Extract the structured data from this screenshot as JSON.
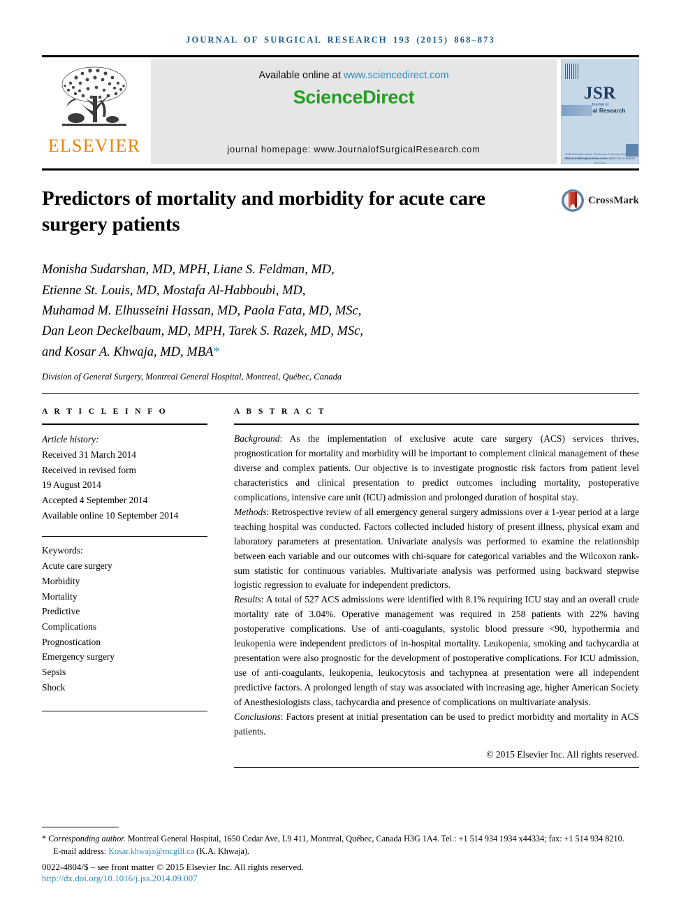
{
  "running_head": "JOURNAL OF SURGICAL RESEARCH 193 (2015) 868–873",
  "masthead": {
    "publisher_name": "ELSEVIER",
    "available_prefix": "Available online at ",
    "available_url": "www.sciencedirect.com",
    "sciencedirect_logo": "ScienceDirect",
    "journal_homepage": "journal homepage: www.JournalofSurgicalResearch.com",
    "cover": {
      "abbr": "JSR",
      "sub_small": "Journal of",
      "sub_main": "Surgical Research",
      "tagline": "Official Publication of the Association for Academic Surgery",
      "bottom_note": "ISSN 0022-4804 Volume 193 Number 2 February 2015\nwww.JournalofSurgicalResearch.com"
    }
  },
  "article": {
    "title": "Predictors of mortality and morbidity for acute care surgery patients",
    "crossmark_label": "CrossMark",
    "authors": [
      "Monisha Sudarshan, MD, MPH, Liane S. Feldman, MD,",
      "Etienne St. Louis, MD, Mostafa Al-Habboubi, MD,",
      "Muhamad M. Elhusseini Hassan, MD, Paola Fata, MD, MSc,",
      "Dan Leon Deckelbaum, MD, MPH, Tarek S. Razek, MD, MSc,",
      "and Kosar A. Khwaja, MD, MBA"
    ],
    "author_marker": "*",
    "affiliation": "Division of General Surgery, Montreal General Hospital, Montreal, Québec, Canada"
  },
  "article_info": {
    "heading": "A R T I C L E   I N F O",
    "history_label": "Article history:",
    "history": [
      "Received 31 March 2014",
      "Received in revised form",
      "19 August 2014",
      "Accepted 4 September 2014",
      "Available online 10 September 2014"
    ],
    "keywords_label": "Keywords:",
    "keywords": [
      "Acute care surgery",
      "Morbidity",
      "Mortality",
      "Predictive",
      "Complications",
      "Prognostication",
      "Emergency surgery",
      "Sepsis",
      "Shock"
    ]
  },
  "abstract": {
    "heading": "A B S T R A C T",
    "sections": [
      {
        "label": "Background",
        "text": ": As the implementation of exclusive acute care surgery (ACS) services thrives, prognostication for mortality and morbidity will be important to complement clinical management of these diverse and complex patients. Our objective is to investigate prognostic risk factors from patient level characteristics and clinical presentation to predict outcomes including mortality, postoperative complications, intensive care unit (ICU) admission and prolonged duration of hospital stay."
      },
      {
        "label": "Methods",
        "text": ": Retrospective review of all emergency general surgery admissions over a 1-year period at a large teaching hospital was conducted. Factors collected included history of present illness, physical exam and laboratory parameters at presentation. Univariate analysis was performed to examine the relationship between each variable and our outcomes with chi-square for categorical variables and the Wilcoxon rank-sum statistic for continuous variables. Multivariate analysis was performed using backward stepwise logistic regression to evaluate for independent predictors."
      },
      {
        "label": "Results",
        "text": ": A total of 527 ACS admissions were identified with 8.1% requiring ICU stay and an overall crude mortality rate of 3.04%. Operative management was required in 258 patients with 22% having postoperative complications. Use of anti-coagulants, systolic blood pressure <90, hypothermia and leukopenia were independent predictors of in-hospital mortality. Leukopenia, smoking and tachycardia at presentation were also prognostic for the development of postoperative complications. For ICU admission, use of anti-coagulants, leukopenia, leukocytosis and tachypnea at presentation were all independent predictive factors. A prolonged length of stay was associated with increasing age, higher American Society of Anesthesiologists class, tachycardia and presence of complications on multivariate analysis."
      },
      {
        "label": "Conclusions",
        "text": ": Factors present at initial presentation can be used to predict morbidity and mortality in ACS patients."
      }
    ],
    "copyright": "© 2015 Elsevier Inc. All rights reserved."
  },
  "footer": {
    "corresponding_marker": "*",
    "corresponding_label": "Corresponding author.",
    "corresponding_text": " Montreal General Hospital, 1650 Cedar Ave, L9 411, Montreal, Québec, Canada H3G 1A4. Tel.: +1 514 934 1934 x44334; fax: +1 514 934 8210.",
    "email_label": "E-mail address: ",
    "email": "Kosar.khwaja@mcgill.ca",
    "email_suffix": " (K.A. Khwaja).",
    "issn_line": "0022-4804/$ – see front matter © 2015 Elsevier Inc. All rights reserved.",
    "doi": "http://dx.doi.org/10.1016/j.jss.2014.09.007"
  },
  "colors": {
    "runhead_blue": "#1a5c8f",
    "link_blue": "#2e8bc0",
    "elsevier_orange": "#f08000",
    "sciencedirect_green": "#22a022",
    "cover_blue": "#c6d7e8"
  }
}
